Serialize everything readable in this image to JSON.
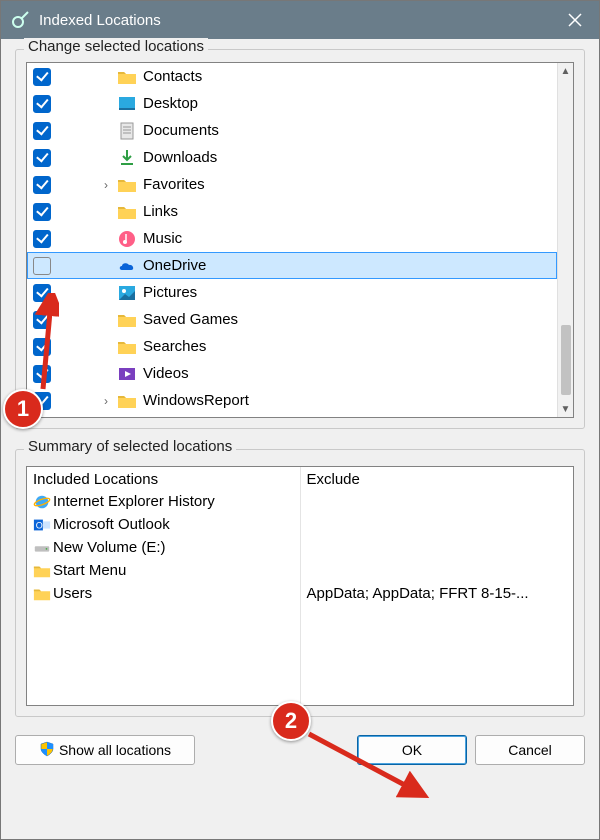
{
  "title": "Indexed Locations",
  "group1_label": "Change selected locations",
  "group2_label": "Summary of selected locations",
  "tree": [
    {
      "label": "Contacts",
      "checked": true,
      "icon": "folder",
      "expander": ""
    },
    {
      "label": "Desktop",
      "checked": true,
      "icon": "desktop",
      "expander": ""
    },
    {
      "label": "Documents",
      "checked": true,
      "icon": "document",
      "expander": ""
    },
    {
      "label": "Downloads",
      "checked": true,
      "icon": "download",
      "expander": ""
    },
    {
      "label": "Favorites",
      "checked": true,
      "icon": "folder",
      "expander": "›"
    },
    {
      "label": "Links",
      "checked": true,
      "icon": "folder",
      "expander": ""
    },
    {
      "label": "Music",
      "checked": true,
      "icon": "music",
      "expander": ""
    },
    {
      "label": "OneDrive",
      "checked": false,
      "icon": "onedrive",
      "expander": "",
      "selected": true
    },
    {
      "label": "Pictures",
      "checked": true,
      "icon": "pictures",
      "expander": ""
    },
    {
      "label": "Saved Games",
      "checked": true,
      "icon": "folder",
      "expander": ""
    },
    {
      "label": "Searches",
      "checked": true,
      "icon": "folder",
      "expander": ""
    },
    {
      "label": "Videos",
      "checked": true,
      "icon": "videos",
      "expander": ""
    },
    {
      "label": "WindowsReport",
      "checked": true,
      "icon": "folder",
      "expander": "›"
    }
  ],
  "summary": {
    "included_header": "Included Locations",
    "exclude_header": "Exclude",
    "included": [
      {
        "label": "Internet Explorer History",
        "icon": "ie"
      },
      {
        "label": "Microsoft Outlook",
        "icon": "outlook"
      },
      {
        "label": "New Volume (E:)",
        "icon": "drive"
      },
      {
        "label": "Start Menu",
        "icon": "folder"
      },
      {
        "label": "Users",
        "icon": "folder"
      }
    ],
    "exclude": [
      {
        "label": ""
      },
      {
        "label": ""
      },
      {
        "label": ""
      },
      {
        "label": ""
      },
      {
        "label": "AppData; AppData; FFRT 8-15-..."
      }
    ]
  },
  "buttons": {
    "show_all": "Show all locations",
    "ok": "OK",
    "cancel": "Cancel"
  },
  "annotations": {
    "step1": "1",
    "step2": "2"
  }
}
